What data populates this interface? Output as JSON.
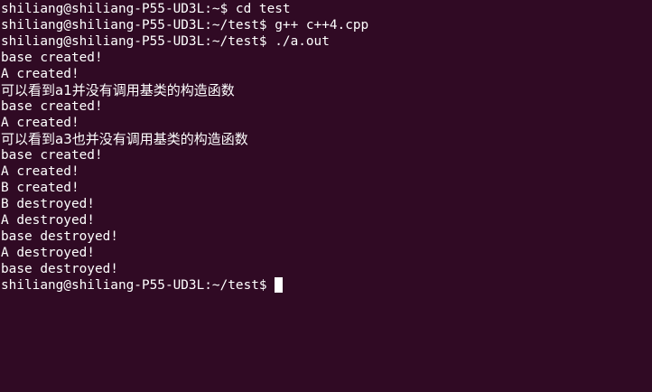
{
  "terminal": {
    "lines": [
      {
        "kind": "prompt",
        "text": "shiliang@shiliang-P55-UD3L:~$ cd test"
      },
      {
        "kind": "prompt",
        "text": "shiliang@shiliang-P55-UD3L:~/test$ g++ c++4.cpp"
      },
      {
        "kind": "prompt",
        "text": "shiliang@shiliang-P55-UD3L:~/test$ ./a.out"
      },
      {
        "kind": "output",
        "text": "base created!"
      },
      {
        "kind": "output",
        "text": "A created!"
      },
      {
        "kind": "output-cjk",
        "text": "可以看到a1并没有调用基类的构造函数"
      },
      {
        "kind": "output",
        "text": "base created!"
      },
      {
        "kind": "output",
        "text": "A created!"
      },
      {
        "kind": "output-cjk",
        "text": "可以看到a3也并没有调用基类的构造函数"
      },
      {
        "kind": "output",
        "text": "base created!"
      },
      {
        "kind": "output",
        "text": "A created!"
      },
      {
        "kind": "output",
        "text": "B created!"
      },
      {
        "kind": "output",
        "text": "B destroyed!"
      },
      {
        "kind": "output",
        "text": "A destroyed!"
      },
      {
        "kind": "output",
        "text": "base destroyed!"
      },
      {
        "kind": "output",
        "text": "A destroyed!"
      },
      {
        "kind": "output",
        "text": "base destroyed!"
      }
    ],
    "current_prompt": "shiliang@shiliang-P55-UD3L:~/test$ ",
    "colors": {
      "background": "#300a24",
      "foreground": "#ffffff"
    }
  }
}
